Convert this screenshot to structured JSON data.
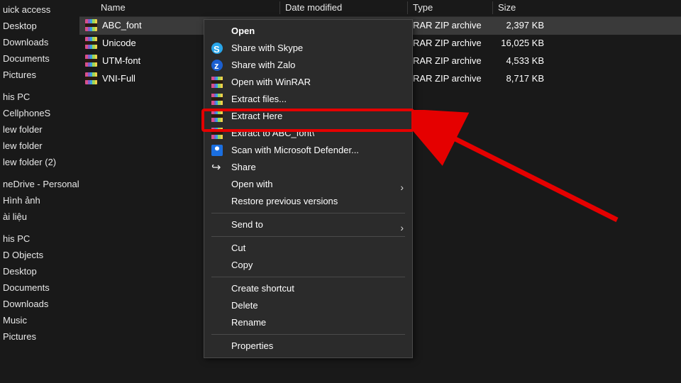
{
  "columns": {
    "name": "Name",
    "date": "Date modified",
    "type": "Type",
    "size": "Size"
  },
  "sidebar": {
    "items": [
      "uick access",
      "Desktop",
      "Downloads",
      "Documents",
      "Pictures",
      "his PC",
      "CellphoneS",
      "lew folder",
      "lew folder",
      "lew folder (2)",
      "neDrive - Personal",
      "Hình ảnh",
      "ài liệu",
      "his PC",
      "D Objects",
      "Desktop",
      "Documents",
      "Downloads",
      "Music",
      "Pictures"
    ],
    "gaps_after": [
      4,
      9,
      12
    ]
  },
  "files": [
    {
      "name": "ABC_font",
      "type": "RAR ZIP archive",
      "size": "2,397 KB",
      "selected": true
    },
    {
      "name": "Unicode",
      "type": "RAR ZIP archive",
      "size": "16,025 KB",
      "selected": false
    },
    {
      "name": "UTM-font",
      "type": "RAR ZIP archive",
      "size": "4,533 KB",
      "selected": false
    },
    {
      "name": "VNI-Full",
      "type": "RAR ZIP archive",
      "size": "8,717 KB",
      "selected": false
    }
  ],
  "menu": [
    {
      "label": "Open",
      "bold": true
    },
    {
      "label": "Share with Skype",
      "icon": "skype"
    },
    {
      "label": "Share with Zalo",
      "icon": "zalo"
    },
    {
      "label": "Open with WinRAR",
      "icon": "rar"
    },
    {
      "label": "Extract files...",
      "icon": "rar"
    },
    {
      "label": "Extract Here",
      "icon": "rar"
    },
    {
      "label": "Extract to ABC_font\\",
      "icon": "rar"
    },
    {
      "label": "Scan with Microsoft Defender...",
      "icon": "defender"
    },
    {
      "label": "Share",
      "icon": "share"
    },
    {
      "label": "Open with",
      "submenu": true
    },
    {
      "label": "Restore previous versions"
    },
    {
      "sep": true
    },
    {
      "label": "Send to",
      "submenu": true
    },
    {
      "sep": true
    },
    {
      "label": "Cut"
    },
    {
      "label": "Copy"
    },
    {
      "sep": true
    },
    {
      "label": "Create shortcut"
    },
    {
      "label": "Delete"
    },
    {
      "label": "Rename"
    },
    {
      "sep": true
    },
    {
      "label": "Properties"
    }
  ],
  "highlight_menu_index": 5
}
